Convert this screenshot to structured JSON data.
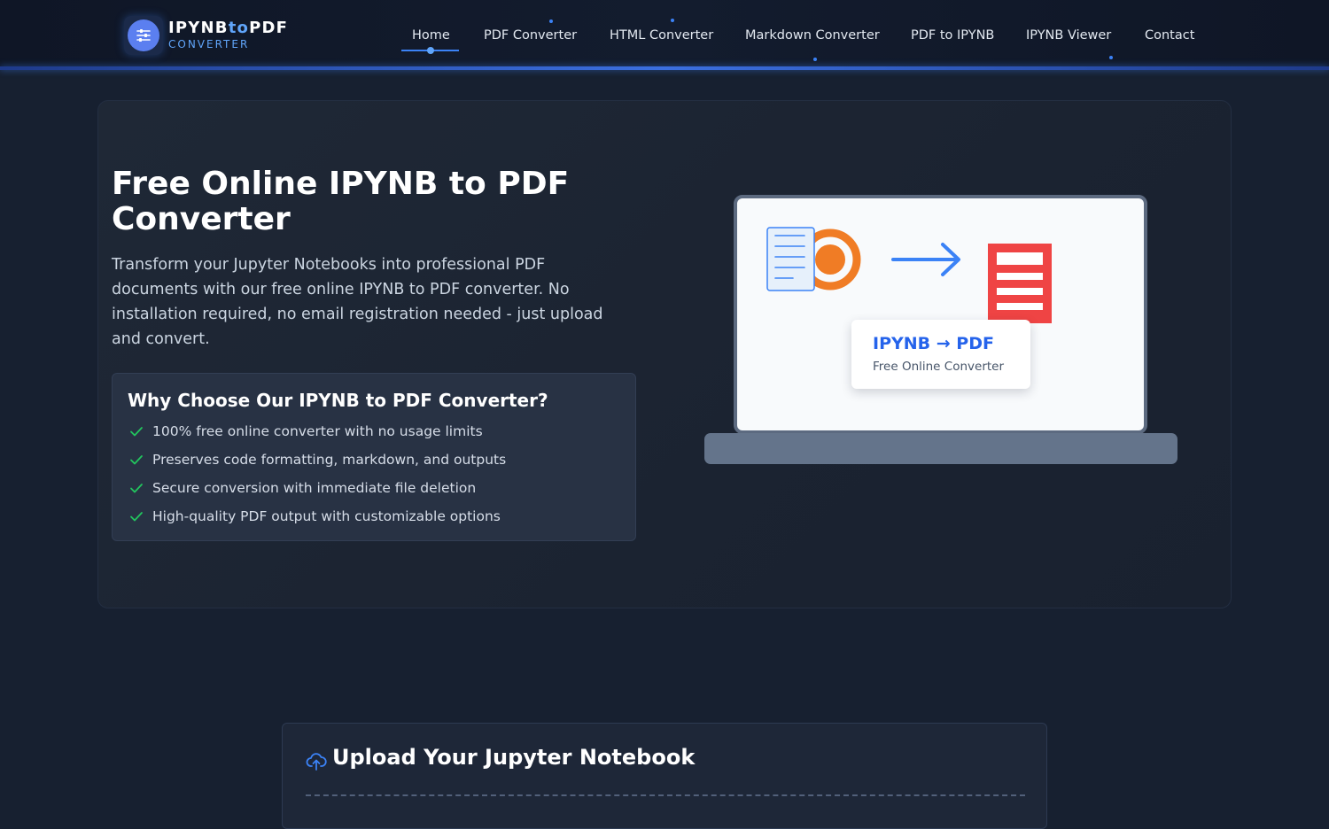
{
  "brand": {
    "title_part1": "IPYNB",
    "title_part2": "to",
    "title_part3": "PDF",
    "subtitle": "CONVERTER",
    "logo_icon": "sliders-icon"
  },
  "nav": {
    "items": [
      {
        "label": "Home",
        "active": true
      },
      {
        "label": "PDF Converter"
      },
      {
        "label": "HTML Converter"
      },
      {
        "label": "Markdown Converter"
      },
      {
        "label": "PDF to IPYNB"
      },
      {
        "label": "IPYNB Viewer"
      },
      {
        "label": "Contact"
      }
    ]
  },
  "hero": {
    "title": "Free Online IPYNB to PDF Converter",
    "description": "Transform your Jupyter Notebooks into professional PDF documents with our free online IPYNB to PDF converter. No installation required, no email registration needed - just upload and convert.",
    "why_title": "Why Choose Our IPYNB to PDF Converter?",
    "why_items": [
      "100% free online converter with no usage limits",
      "Preserves code formatting, markdown, and outputs",
      "Secure conversion with immediate file deletion",
      "High-quality PDF output with customizable options"
    ],
    "check_icon": "check-icon"
  },
  "illustration": {
    "card_title": "IPYNB → PDF",
    "card_subtitle": "Free Online Converter",
    "icons": [
      "notebook-document-icon",
      "jupyter-ring-icon",
      "arrow-right-icon",
      "pdf-document-icon"
    ]
  },
  "upload": {
    "title": "Upload Your Jupyter Notebook",
    "icon": "cloud-upload-icon"
  },
  "colors": {
    "accent": "#3b82f6",
    "accent_light": "#60a5fa",
    "background": "#172030",
    "check_green": "#22c55e",
    "jupyter_orange": "#f07c25",
    "pdf_red": "#ef4444"
  }
}
